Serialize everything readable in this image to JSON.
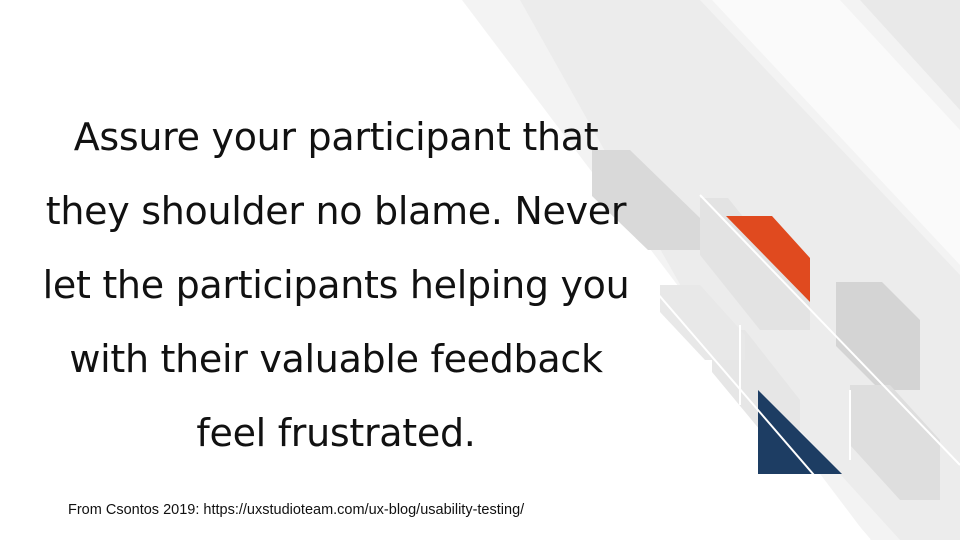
{
  "slide": {
    "quote_lines": [
      "Assure your participant that",
      "they shoulder no blame. Never",
      "let the participants helping you",
      "with their valuable feedback",
      "feel frustrated."
    ],
    "citation": "From Csontos 2019: https://uxstudioteam.com/ux-blog/usability-testing/"
  },
  "colors": {
    "background": "#ffffff",
    "text": "#111111",
    "accent_orange": "#e04a1f",
    "accent_navy": "#1d3d63",
    "decor_light_gray": "#efefef",
    "decor_mid_gray": "#dcdcdc",
    "decor_dark_gray": "#cfcfcf"
  }
}
